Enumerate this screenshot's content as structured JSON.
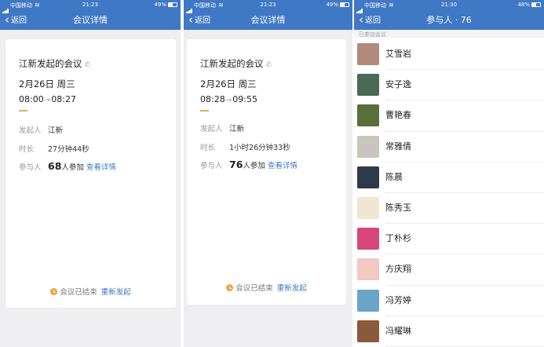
{
  "screens": [
    {
      "status": {
        "carrier": "中国移动",
        "time": "21:23",
        "battery": "49%"
      },
      "nav": {
        "back": "返回",
        "title": "会议详情"
      },
      "meeting": {
        "title": "江新发起的会议",
        "date": "2月26日 周三",
        "start": "08:00",
        "end": "08:27",
        "initiator_label": "发起人",
        "initiator": "江新",
        "duration_label": "时长",
        "duration": "27分钟44秒",
        "participants_label": "参与人",
        "participants_count": "68",
        "participants_suffix": "人参加",
        "view_details": "查看详情",
        "ended_text": "会议已结束",
        "restart": "重新发起"
      }
    },
    {
      "status": {
        "carrier": "中国移动",
        "time": "21:23",
        "battery": "49%"
      },
      "nav": {
        "back": "返回",
        "title": "会议详情"
      },
      "meeting": {
        "title": "江新发起的会议",
        "date": "2月26日 周三",
        "start": "08:28",
        "end": "09:55",
        "initiator_label": "发起人",
        "initiator": "江新",
        "duration_label": "时长",
        "duration": "1小时26分钟33秒",
        "participants_label": "参与人",
        "participants_count": "76",
        "participants_suffix": "人参加",
        "view_details": "查看详情",
        "ended_text": "会议已结束",
        "restart": "重新发起"
      }
    },
    {
      "status": {
        "carrier": "中国移动",
        "time": "21:30",
        "battery": "48%"
      },
      "nav": {
        "back": "返回",
        "title": "参与人 · 76"
      },
      "section_label": "已参加会议",
      "participants": [
        {
          "name": "艾雪岩",
          "avatar_color": "#b08a7a"
        },
        {
          "name": "安子逸",
          "avatar_color": "#4a6a55"
        },
        {
          "name": "曹艳春",
          "avatar_color": "#5a6e3a"
        },
        {
          "name": "常雅倩",
          "avatar_color": "#c9c4bd"
        },
        {
          "name": "陈晨",
          "avatar_color": "#2e3a4a"
        },
        {
          "name": "陈秀玉",
          "avatar_color": "#efe6d4"
        },
        {
          "name": "丁朴杉",
          "avatar_color": "#d9477a"
        },
        {
          "name": "方庆翔",
          "avatar_color": "#f2c7c4"
        },
        {
          "name": "冯芳婷",
          "avatar_color": "#6aa4c8"
        },
        {
          "name": "冯耀琳",
          "avatar_color": "#8a5a3c"
        }
      ]
    }
  ],
  "colors": {
    "header": "#3f78c5",
    "link": "#3f78c5",
    "accent_gold": "#d8b05e",
    "status_orange": "#f0a33a"
  }
}
